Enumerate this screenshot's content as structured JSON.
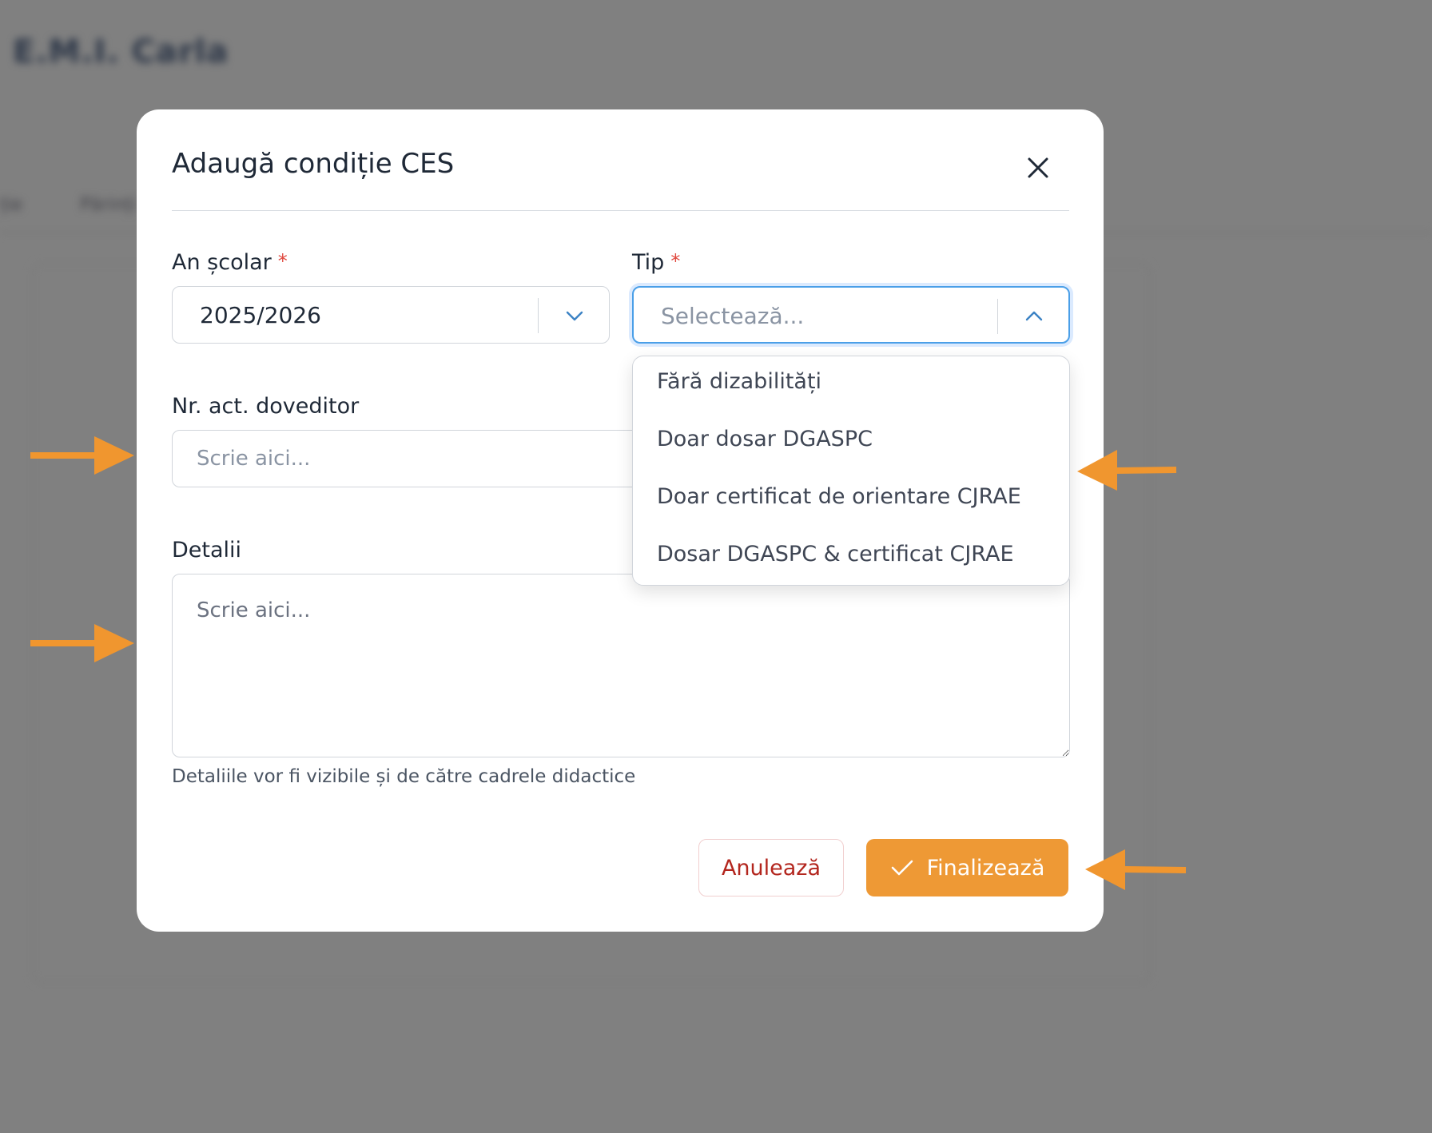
{
  "background": {
    "title": "E.M.I. Carla",
    "tabs": [
      "ție",
      "Părinți"
    ]
  },
  "modal": {
    "title": "Adaugă condiție CES",
    "close_icon": "close-icon"
  },
  "form": {
    "school_year": {
      "label": "An școlar",
      "required_mark": "*",
      "value": "2025/2026",
      "icon": "chevron-down-icon"
    },
    "type": {
      "label": "Tip",
      "required_mark": "*",
      "placeholder": "Selectează...",
      "icon": "chevron-up-icon",
      "options": [
        "Fără dizabilități",
        "Doar dosar DGASPC",
        "Doar certificat de orientare CJRAE",
        "Dosar DGASPC & certificat CJRAE"
      ]
    },
    "proof_act": {
      "label": "Nr. act. doveditor",
      "placeholder": "Scrie aici..."
    },
    "details": {
      "label": "Detalii",
      "placeholder": "Scrie aici...",
      "helper": "Detaliile vor fi vizibile și de către cadrele didactice"
    }
  },
  "actions": {
    "cancel_label": "Anulează",
    "submit_label": "Finalizează",
    "submit_icon": "check-icon"
  },
  "colors": {
    "accent": "#ee9935",
    "danger": "#b3261e",
    "focus": "#4a9fe8",
    "overlay": "#808080",
    "annotation_arrow": "#f0962f"
  }
}
